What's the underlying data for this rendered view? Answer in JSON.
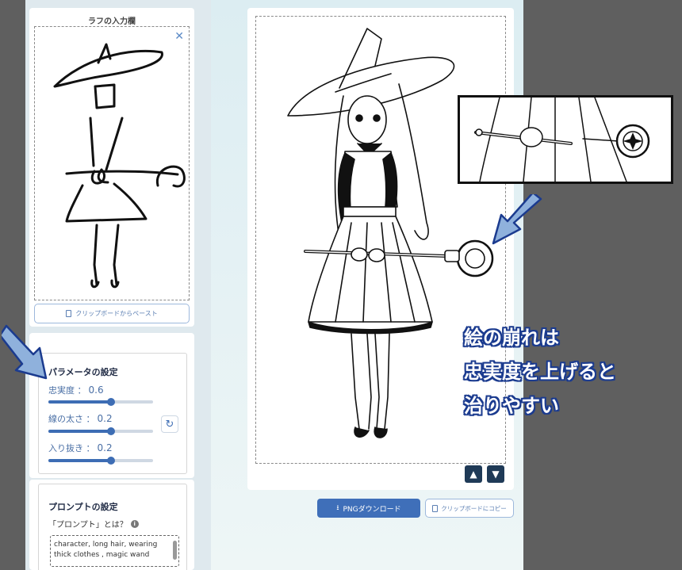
{
  "rough_panel": {
    "title": "ラフの入力欄",
    "close_icon": "close-icon",
    "paste_button": "クリップボードからペースト"
  },
  "parameters": {
    "title": "パラメータの設定",
    "items": [
      {
        "label": "忠実度",
        "value": "0.6",
        "fraction": 0.6
      },
      {
        "label": "線の太さ",
        "value": "0.2",
        "fraction": 0.6
      },
      {
        "label": "入り抜き",
        "value": "0.2",
        "fraction": 0.6
      }
    ],
    "reset_icon": "refresh-icon"
  },
  "prompt": {
    "title": "プロンプトの設定",
    "help": "「プロンプト」とは？",
    "text_line1": "character, long hair, wearing",
    "text_line2": "thick clothes , magic wand"
  },
  "output": {
    "download_button": "PNGダウンロード",
    "copy_button": "クリップボードにコピー",
    "like_icon": "thumbs-up-icon",
    "dislike_icon": "thumbs-down-icon"
  },
  "annotation": {
    "line1": "絵の崩れは",
    "line2": "忠実度を上げると",
    "line3": "治りやすい",
    "arrow_color": "#8fb1dc",
    "text_outline_color": "#1b3b8f"
  }
}
